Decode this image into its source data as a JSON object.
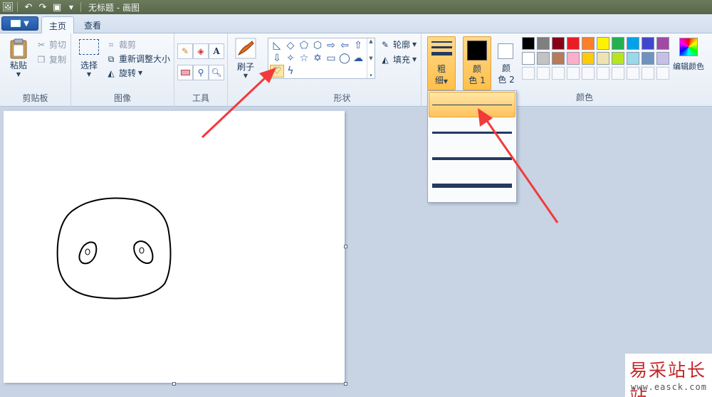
{
  "window": {
    "title": "无标题 - 画图"
  },
  "tabs": [
    {
      "label": "主页",
      "active": true
    },
    {
      "label": "查看",
      "active": false
    }
  ],
  "ribbon": {
    "clipboard": {
      "label": "剪贴板",
      "paste": "粘贴",
      "cut": "剪切",
      "copy": "复制"
    },
    "image": {
      "label": "图像",
      "select": "选择",
      "crop": "裁剪",
      "resize": "重新调整大小",
      "rotate": "旋转"
    },
    "tools": {
      "label": "工具"
    },
    "brushes": {
      "label": "刷子"
    },
    "shapes": {
      "label": "形状",
      "outline": "轮廓",
      "fill": "填充",
      "selected_shape": "heart"
    },
    "thickness": {
      "label_line1": "粗",
      "label_line2": "细"
    },
    "colors": {
      "label": "颜色",
      "color1_line1": "颜",
      "color1_line2": "色 1",
      "color2_line1": "颜",
      "color2_line2": "色 2",
      "edit": "编辑颜色",
      "color1_value": "#000000",
      "color2_value": "#ffffff",
      "palette_row1": [
        "#000000",
        "#7f7f7f",
        "#880015",
        "#ed1c24",
        "#ff7f27",
        "#fff200",
        "#22b14c",
        "#00a2e8",
        "#3f48cc",
        "#a349a4"
      ],
      "palette_row2": [
        "#ffffff",
        "#c3c3c3",
        "#b97a57",
        "#ffaec9",
        "#ffc90e",
        "#efe4b0",
        "#b5e61d",
        "#99d9ea",
        "#7092be",
        "#c8bfe7"
      ]
    }
  },
  "thickness_menu": {
    "options": [
      "1px",
      "3px",
      "5px",
      "8px"
    ],
    "highlighted_index": 0
  },
  "watermark": {
    "title": "易采站长站",
    "url": "www.easck.com"
  }
}
